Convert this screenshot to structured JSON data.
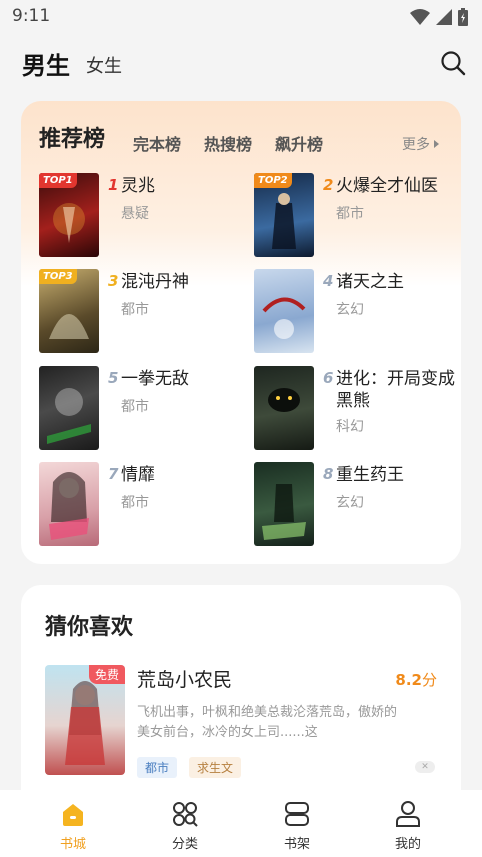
{
  "status_bar": {
    "time": "9:11"
  },
  "nav": {
    "tabs": [
      "男生",
      "女生"
    ],
    "active_tab": "男生"
  },
  "ranking": {
    "title": "推荐榜",
    "tabs": [
      "完本榜",
      "热搜榜",
      "飙升榜"
    ],
    "more_label": "更多",
    "books": [
      {
        "rank": "1",
        "title": "灵兆",
        "genre": "悬疑",
        "badge": "TOP1"
      },
      {
        "rank": "2",
        "title": "火爆全才仙医",
        "genre": "都市",
        "badge": "TOP2"
      },
      {
        "rank": "3",
        "title": "混沌丹神",
        "genre": "都市",
        "badge": "TOP3"
      },
      {
        "rank": "4",
        "title": "诸天之主",
        "genre": "玄幻"
      },
      {
        "rank": "5",
        "title": "一拳无敌",
        "genre": "都市"
      },
      {
        "rank": "6",
        "title": "进化：开局变成黑熊",
        "genre": "科幻"
      },
      {
        "rank": "7",
        "title": "情靡",
        "genre": "都市"
      },
      {
        "rank": "8",
        "title": "重生药王",
        "genre": "玄幻"
      }
    ]
  },
  "guess": {
    "title": "猜你喜欢",
    "book": {
      "title": "荒岛小农民",
      "score": "8.2",
      "score_unit": "分",
      "free_label": "免费",
      "description": "飞机出事，叶枫和绝美总裁沦落荒岛，傲娇的美女前台，冰冷的女上司......这",
      "tags": [
        "都市",
        "求生文"
      ]
    }
  },
  "bottom_nav": {
    "items": [
      "书城",
      "分类",
      "书架",
      "我的"
    ],
    "active": "书城"
  },
  "colors": {
    "accent": "#f0a020",
    "rank_gold": "#f08a1a"
  }
}
